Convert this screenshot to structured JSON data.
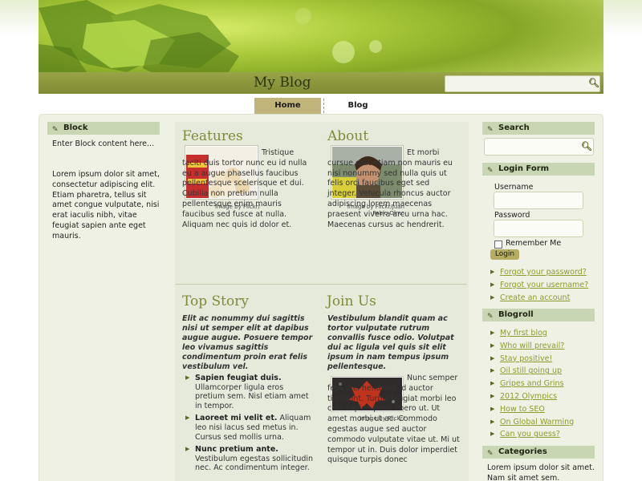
{
  "site": {
    "title": "My Blog"
  },
  "nav": {
    "tabs": [
      {
        "label": "Home"
      },
      {
        "label": "Blog"
      }
    ]
  },
  "left": {
    "block_title": "Block",
    "intro": "Enter Block content here...",
    "body": "Lorem ipsum dolor sit amet, consectetur adipiscing elit. Etiam pharetra, tellus sit amet congue vulputate, nisi erat iaculis nibh, vitae feugiat sapien ante eget mauris."
  },
  "features": {
    "title": "Features",
    "caption": "Image by Flickr/",
    "text": "Tristique taciti duis tortor nunc eu id nulla eu a augue phasellus faucibus pellentesque scelerisque et dui. Cubilia non pretium nulla pellentesque enim mauris faucibus sed fusce at nulla. Aliquam nec quis id dolor et."
  },
  "about": {
    "title": "About",
    "caption1": "Image by Flickr/Juan",
    "caption2": "Pablo Olmo",
    "text": "Et morbi cursue erat etiam non mauris eu nisi nonummy sed nulla quis ut felis orci faucibus eget sed jnteger. Vehicula rhoncus auctor adipiscing lorem maecenas praesent viverra arcu urna hac. Maecenas cursus ac hendrerit."
  },
  "top_story": {
    "title": "Top Story",
    "lead": "Elit ac nonummy dui sagittis nisi ut semper elit at dapibus augue augue. Posuere tempor leo vivamus sagittis condimentum proin erat felis vestibulum vel.",
    "items": [
      {
        "head": "Sapien feugiat duis.",
        "text": "Ullamcorper ligula eros pretium sem. Nisl etiam amet in tempor."
      },
      {
        "head": "Laoreet mi velit et.",
        "text": "Aliquam leo nisi lacus sed metus in. Cursus sed mollis urna."
      },
      {
        "head": "Nunc pretium ante.",
        "text": "Vestibulum egestas sollicitudin nec. Ac condimentum integer."
      }
    ]
  },
  "join_us": {
    "title": "Join Us",
    "lead": "Vestibulum blandit quam ac tortor vulputate rutrum convallis fusce odio. Volutpat dui ac ligula vel quis sit elit ipsum in nam tempus ipsum pellentesque.",
    "caption": "Image by Flickr/",
    "text": "Nunc semper felis orci hendrerit id auctor tincidunt. Turpis feugiat morbi leo cras sapien pede libero ut. Ut amet morbi ut ac. Commodo egestas augue sed auctor commodo vulputate vitae ut. Mi ut tempor ut in. Duis dolor imperdiet quisque turpis donec"
  },
  "right": {
    "search_title": "Search",
    "login_title": "Login Form",
    "username_label": "Username",
    "password_label": "Password",
    "remember_label": "Remember Me",
    "login_button": "Login",
    "login_links": [
      "Forgot your password?",
      "Forgot your username?",
      "Create an account"
    ],
    "blogroll_title": "Blogroll",
    "blogroll": [
      "My first blog",
      "Who will prevail?",
      "Stay positive!",
      "Oil still going up",
      "Gripes and Grins",
      "2012 Olympics",
      "How to SEO",
      "On Global Warming",
      "Can you guess?"
    ],
    "categories_title": "Categories",
    "categories_text": "Lorem ipsum dolor sit amet. Nam sit amet sem."
  },
  "colors": {
    "accent": "#7f8a38",
    "link": "#8f9a2c",
    "block_head": "#c9d6b4",
    "active_tab": "#c1b47b"
  },
  "icons": [
    "search-icon",
    "pencil-icon"
  ]
}
